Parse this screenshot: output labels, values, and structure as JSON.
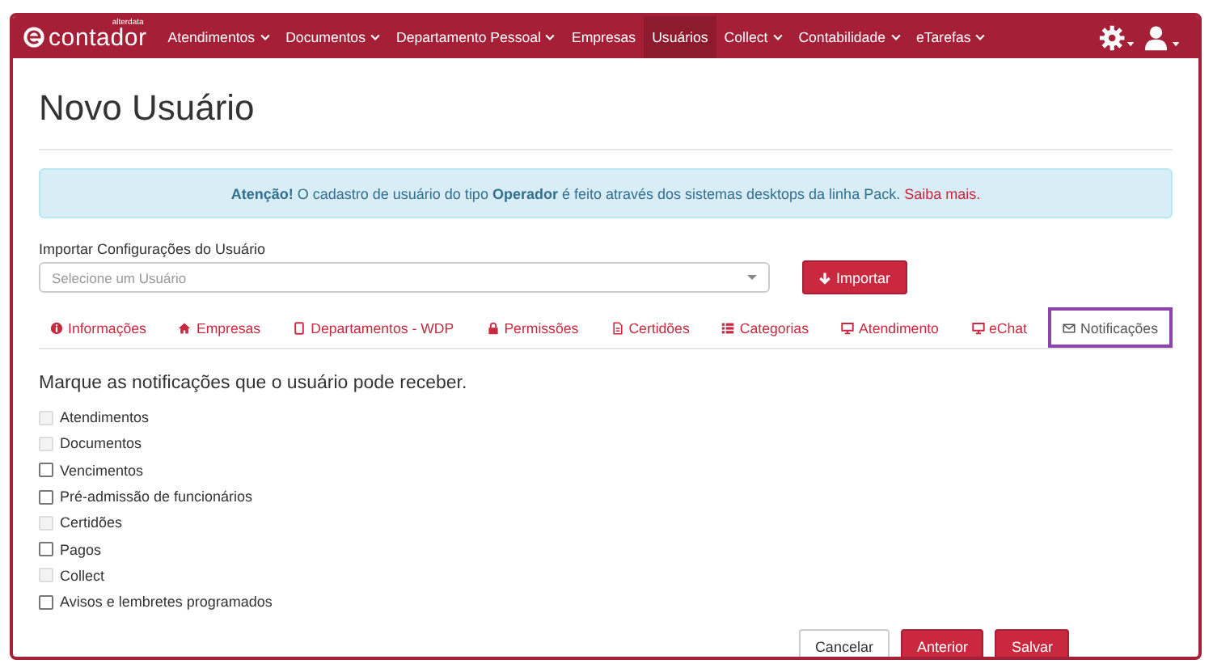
{
  "brand": {
    "name": "contador",
    "tag": "alterdata"
  },
  "nav": [
    {
      "label": "Atendimentos",
      "dropdown": true,
      "selected": false
    },
    {
      "label": "Documentos",
      "dropdown": true,
      "selected": false
    },
    {
      "label": "Departamento Pessoal",
      "dropdown": true,
      "selected": false
    },
    {
      "label": "Empresas",
      "dropdown": false,
      "selected": false
    },
    {
      "label": "Usuários",
      "dropdown": false,
      "selected": true
    },
    {
      "label": "Collect",
      "dropdown": true,
      "selected": false
    },
    {
      "label": "Contabilidade",
      "dropdown": true,
      "selected": false
    },
    {
      "label": "eTarefas",
      "dropdown": true,
      "selected": false
    }
  ],
  "title": "Novo Usuário",
  "alert": "**Atenção!** O cadastro de usuário do tipo **Operador** é feito através dos sistemas desktops da linha Pack.",
  "alert_link": "Saiba mais.",
  "import": {
    "label": "Importar Configurações do Usuário",
    "placeholder": "Selecione um Usuário",
    "button": "Importar"
  },
  "tabs": [
    {
      "label": "Informações",
      "selected": false
    },
    {
      "label": "Empresas",
      "selected": false
    },
    {
      "label": "Departamentos - WDP",
      "selected": false
    },
    {
      "label": "Permissões",
      "selected": false
    },
    {
      "label": "Certidões",
      "selected": false
    },
    {
      "label": "Categorias",
      "selected": false
    },
    {
      "label": "Atendimento",
      "selected": false
    },
    {
      "label": "eChat",
      "selected": false
    },
    {
      "label": "Notificações",
      "selected": true
    }
  ],
  "heading": "Marque as notificações que o usuário pode receber.",
  "options": [
    {
      "label": "Atendimentos",
      "checked": false,
      "disabled": true
    },
    {
      "label": "Documentos",
      "checked": false,
      "disabled": true
    },
    {
      "label": "Vencimentos",
      "checked": false,
      "disabled": false
    },
    {
      "label": "Pré-admissão de funcionários",
      "checked": false,
      "disabled": false
    },
    {
      "label": "Certidões",
      "checked": false,
      "disabled": true
    },
    {
      "label": "Pagos",
      "checked": false,
      "disabled": false
    },
    {
      "label": "Collect",
      "checked": false,
      "disabled": true
    },
    {
      "label": "Avisos e lembretes programados",
      "checked": false,
      "disabled": false
    }
  ],
  "buttons": [
    {
      "label": "Cancelar",
      "kind": "default"
    },
    {
      "label": "Anterior",
      "kind": "primary"
    },
    {
      "label": "Salvar",
      "kind": "primary"
    }
  ]
}
